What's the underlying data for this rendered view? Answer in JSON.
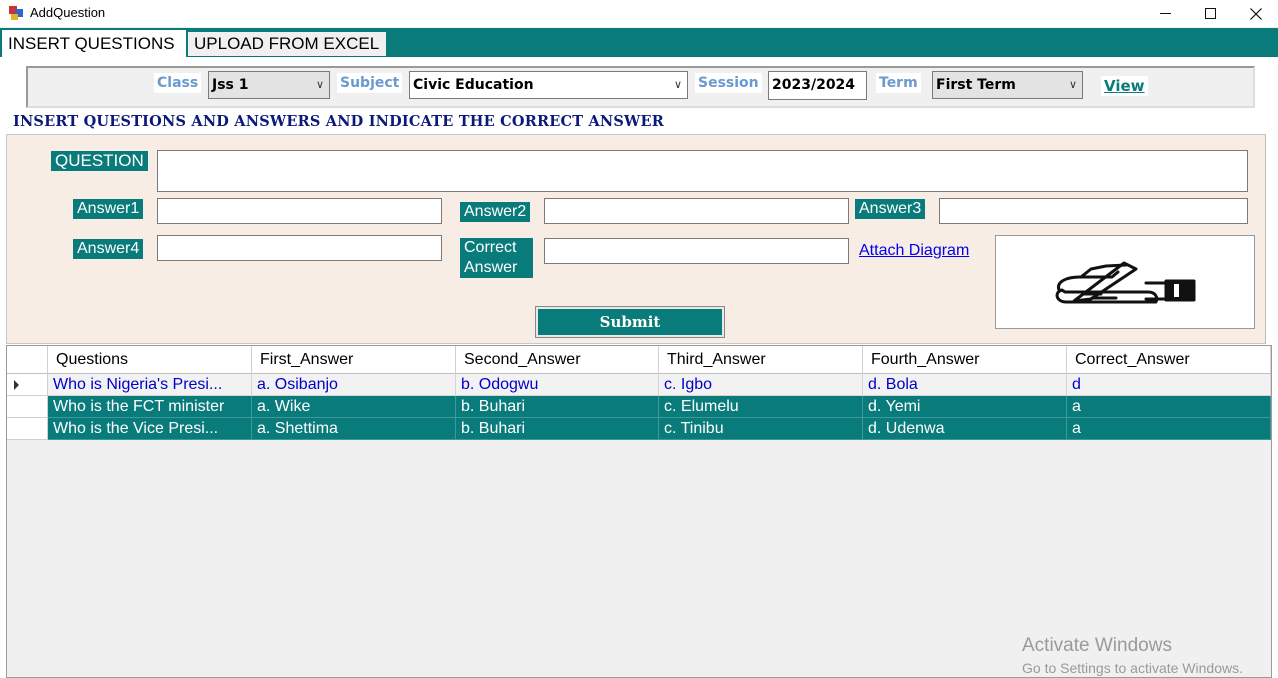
{
  "window": {
    "title": "AddQuestion",
    "icon": "app-icon",
    "controls": [
      "minimize-icon",
      "maximize-icon",
      "close-icon"
    ]
  },
  "tabs": [
    {
      "label": "INSERT QUESTIONS",
      "active": true
    },
    {
      "label": "UPLOAD FROM EXCEL",
      "active": false
    }
  ],
  "filters": {
    "class_label": "Class",
    "class_value": "Jss 1",
    "subject_label": "Subject",
    "subject_value": "Civic Education",
    "session_label": "Session",
    "session_value": "2023/2024",
    "term_label": "Term",
    "term_value": "First Term",
    "view_label": "View"
  },
  "heading": "INSERT QUESTIONS AND ANSWERS AND INDICATE THE CORRECT ANSWER",
  "form": {
    "question_label": "QUESTION",
    "answer1_label": "Answer1",
    "answer2_label": "Answer2",
    "answer3_label": "Answer3",
    "answer4_label": "Answer4",
    "correct_label_line1": "Correct",
    "correct_label_line2": "Answer",
    "attach_label": "Attach Diagram",
    "diagram_icon": "writing-hand-icon",
    "submit_label": "Submit"
  },
  "grid": {
    "columns": [
      "Questions",
      "First_Answer",
      "Second_Answer",
      "Third_Answer",
      "Fourth_Answer",
      "Correct_Answer"
    ],
    "rows": [
      [
        "Who is Nigeria's Presi...",
        "a. Osibanjo",
        "b. Odogwu",
        "c. Igbo",
        "d. Bola",
        "d"
      ],
      [
        "Who is the FCT minister",
        "a. Wike",
        "b. Buhari",
        "c. Elumelu",
        "d. Yemi",
        "a"
      ],
      [
        "Who is the Vice Presi...",
        "a. Shettima",
        "b. Buhari",
        "c. Tinibu",
        "d. Udenwa",
        "a"
      ]
    ],
    "selected_row": 0
  },
  "watermark": {
    "line1": "Activate Windows",
    "line2": "Go to Settings to activate Windows."
  },
  "colors": {
    "accent": "#0a7b7b",
    "heading": "#0b1a7a",
    "label": "#6a9ad0",
    "panel": "#f8ede5"
  }
}
